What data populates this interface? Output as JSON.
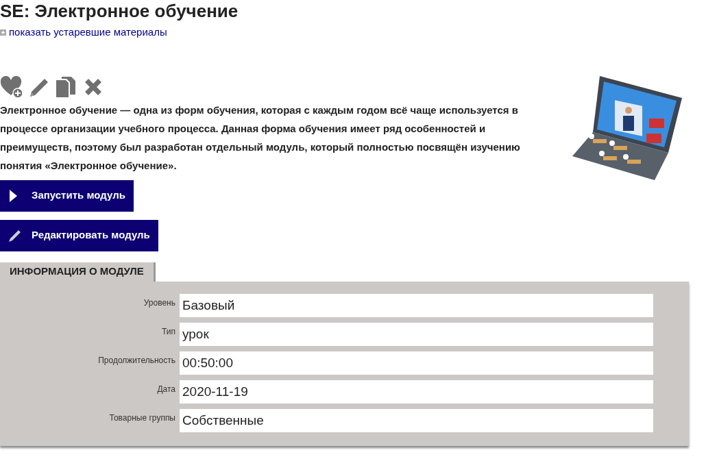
{
  "title": "SE: Электронное обучение",
  "show_link": "показать устаревшие материалы",
  "actions": [
    {
      "kind": "favorite"
    },
    {
      "kind": "edit"
    },
    {
      "kind": "copy"
    },
    {
      "kind": "delete"
    }
  ],
  "description": "Электронное обучение — одна из форм обучения, которая с каждым годом всё чаще используется в процессе организации учебного процесса. Данная форма обучения имеет ряд особенностей и преимуществ, поэтому был разработан отдельный модуль, который полностью посвящён изучению понятия «Электронное обучение».",
  "buttons": [
    {
      "label": "Запустить модуль",
      "kind": "play"
    },
    {
      "label": "Редактировать модуль",
      "kind": "edit"
    }
  ],
  "tabs": [
    {
      "label": "ИНФОРМАЦИЯ О МОДУЛЕ",
      "selected": true
    }
  ],
  "fields": [
    {
      "label": "Уровень",
      "value": "Базовый"
    },
    {
      "label": "Тип",
      "value": "урок"
    },
    {
      "label": "Продолжительность",
      "value": "00:50:00"
    },
    {
      "label": "Дата",
      "value": "2020-11-19"
    },
    {
      "label": "Товарные группы",
      "value": "Собственные"
    }
  ]
}
